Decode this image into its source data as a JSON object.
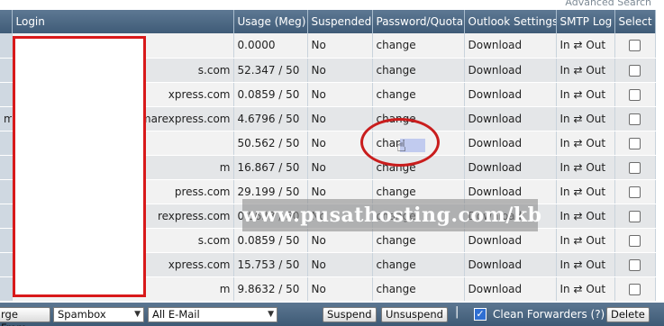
{
  "advanced_search": "Advanced Search",
  "columns": [
    "Login",
    "Usage (Meg)",
    "Suspended",
    "Password/Quota",
    "Outlook Settings",
    "SMTP Log",
    "Select"
  ],
  "rows": [
    {
      "c0": "",
      "login": "",
      "usage": "0.0000",
      "suspended": "No",
      "password": "change",
      "outlook": "Download",
      "smtp": "In ⇄ Out"
    },
    {
      "c0": "",
      "login": "s.com",
      "usage": "52.347 / 50",
      "suspended": "No",
      "password": "change",
      "outlook": "Download",
      "smtp": "In ⇄ Out"
    },
    {
      "c0": "",
      "login": "xpress.com",
      "usage": "0.0859 / 50",
      "suspended": "No",
      "password": "change",
      "outlook": "Download",
      "smtp": "In ⇄ Out"
    },
    {
      "c0": "m",
      "login": "marexpress.com",
      "usage": "4.6796 / 50",
      "suspended": "No",
      "password": "change",
      "outlook": "Download",
      "smtp": "In ⇄ Out"
    },
    {
      "c0": "",
      "login": "",
      "usage": "50.562 / 50",
      "suspended": "No",
      "password": "chan",
      "outlook": "Download",
      "smtp": "In ⇄ Out"
    },
    {
      "c0": "",
      "login": "m",
      "usage": "16.867 / 50",
      "suspended": "No",
      "password": "change",
      "outlook": "Download",
      "smtp": "In ⇄ Out"
    },
    {
      "c0": "",
      "login": "press.com",
      "usage": "29.199 / 50",
      "suspended": "No",
      "password": "change",
      "outlook": "Download",
      "smtp": "In ⇄ Out"
    },
    {
      "c0": "",
      "login": "rexpress.com",
      "usage": "0.8633 / 50",
      "suspended": "No",
      "password": "change",
      "outlook": "Download",
      "smtp": "In ⇄ Out"
    },
    {
      "c0": "",
      "login": "s.com",
      "usage": "0.0859 / 50",
      "suspended": "No",
      "password": "change",
      "outlook": "Download",
      "smtp": "In ⇄ Out"
    },
    {
      "c0": "",
      "login": "xpress.com",
      "usage": "15.753 / 50",
      "suspended": "No",
      "password": "change",
      "outlook": "Download",
      "smtp": "In ⇄ Out"
    },
    {
      "c0": "",
      "login": "m",
      "usage": "9.8632 / 50",
      "suspended": "No",
      "password": "change",
      "outlook": "Download",
      "smtp": "In ⇄ Out"
    }
  ],
  "watermark": "www.pusathosting.com/kb",
  "bottom": {
    "purge_from": "rge From",
    "spambox": "Spambox",
    "all_email": "All E-Mail",
    "suspend": "Suspend",
    "unsuspend": "Unsuspend",
    "separator": "|",
    "clean_forwarders": "Clean Forwarders (?)",
    "delete": "Delete"
  },
  "icons": {
    "checkbox": "checkbox-icon",
    "cursor": "hand-cursor-icon",
    "caret": "chevron-down-icon"
  }
}
